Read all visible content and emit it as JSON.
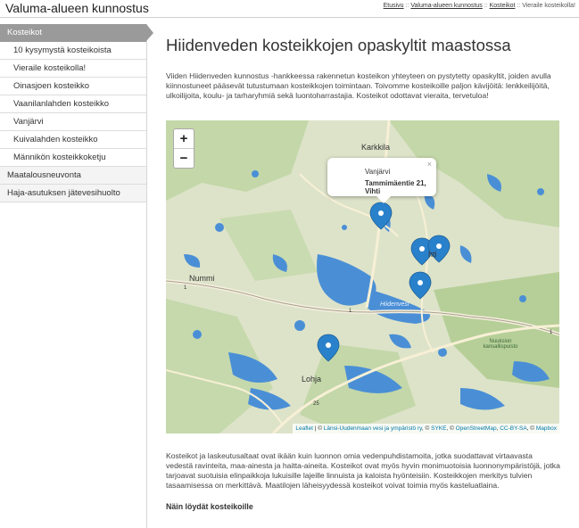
{
  "site": {
    "title": "Valuma-alueen kunnostus"
  },
  "breadcrumb": {
    "items": [
      "Etusivu",
      "Valuma-alueen kunnostus",
      "Kosteikot"
    ],
    "current": "Vieraile kosteikolla!",
    "separator": "::"
  },
  "sidebar": {
    "items": [
      {
        "label": "Kosteikot",
        "level": "top",
        "active": true
      },
      {
        "label": "10 kysymystä kosteikoista",
        "level": "sub"
      },
      {
        "label": "Vieraile kosteikolla!",
        "level": "sub",
        "current": true
      },
      {
        "label": "Oinasjoen kosteikko",
        "level": "sub"
      },
      {
        "label": "Vaanilanlahden kosteikko",
        "level": "sub"
      },
      {
        "label": "Vanjärvi",
        "level": "sub"
      },
      {
        "label": "Kuivalahden kosteikko",
        "level": "sub"
      },
      {
        "label": "Männikön kosteikkoketju",
        "level": "sub"
      },
      {
        "label": "Maatalousneuvonta",
        "level": "top"
      },
      {
        "label": "Haja-asutuksen jätevesihuolto",
        "level": "top"
      }
    ]
  },
  "main": {
    "title": "Hiidenveden kosteikkojen opaskyltit maastossa",
    "intro": "Viiden Hiidenveden kunnostus -hankkeessa rakennetun kosteikon yhteyteen on pystytetty opaskyltit, joiden avulla kiinnostuneet pääsevät tutustumaan kosteikkojen toimintaan. Toivomme kosteikoille paljon kävijöitä: lenkkeilijöitä, ulkoilijoita, koulu- ja tarharyhmiä sekä luontoharrastajia. Kosteikot odottavat vieraita, tervetuloa!",
    "body": "Kosteikot ja laskeutusaltaat ovat ikään kuin luonnon omia vedenpuhdistamoita, jotka suodattavat virtaavasta vedestä ravinteita, maa-ainesta ja haitta-aineita. Kosteikot ovat myös hyvin monimuotoisia luonnonympäristöjä, jotka tarjoavat suotuisia elinpaikkoja lukuisille lajeille linnuista ja kaloista hyönteisiin. Kosteikkojen merkitys tulvien tasaamisessa on merkittävä. Maatilojen läheisyydessä kosteikot voivat toimia myös kasteluatlaina.",
    "subheading": "Näin löydät kosteikoille"
  },
  "map": {
    "zoom_in": "+",
    "zoom_out": "−",
    "popup": {
      "name": "Vanjärvi",
      "address": "Tammimäentie 21, Vihti",
      "close": "×"
    },
    "places": {
      "karkkila": "Karkkila",
      "nummi": "Nummi",
      "lohja": "Lohja",
      "vihti": "hti",
      "hiidenvesi": "Hiidenvesi",
      "nuuksio": "Nuuksion kansallispuisto"
    },
    "road_numbers": {
      "r1a": "1",
      "r1b": "1",
      "r1c": "1",
      "r25": "25"
    },
    "attribution": {
      "leaflet": "Leaflet",
      "sep1": " | © ",
      "owner": "Länsi-Uudenmaan vesi ja ympäristö ry",
      "sep2": ", © ",
      "syke": "SYKE",
      "sep3": ", © ",
      "osm": "OpenStreetMap",
      "sep4": ", ",
      "license": "CC-BY-SA",
      "sep5": ", © ",
      "mapbox": "Mapbox"
    },
    "marker_color": "#2a81cb",
    "water_color": "#4a8fd6",
    "land_color": "#dde3c9",
    "forest_color": "#bcd3a0"
  }
}
